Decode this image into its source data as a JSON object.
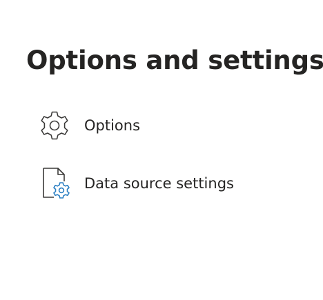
{
  "page": {
    "title": "Options and settings"
  },
  "menu": {
    "items": [
      {
        "label": "Options",
        "icon": "gear-icon"
      },
      {
        "label": "Data source settings",
        "icon": "document-gear-icon"
      }
    ]
  },
  "colors": {
    "text": "#252423",
    "icon_stroke": "#3b3a39",
    "accent_gear": "#2b7fc3"
  }
}
